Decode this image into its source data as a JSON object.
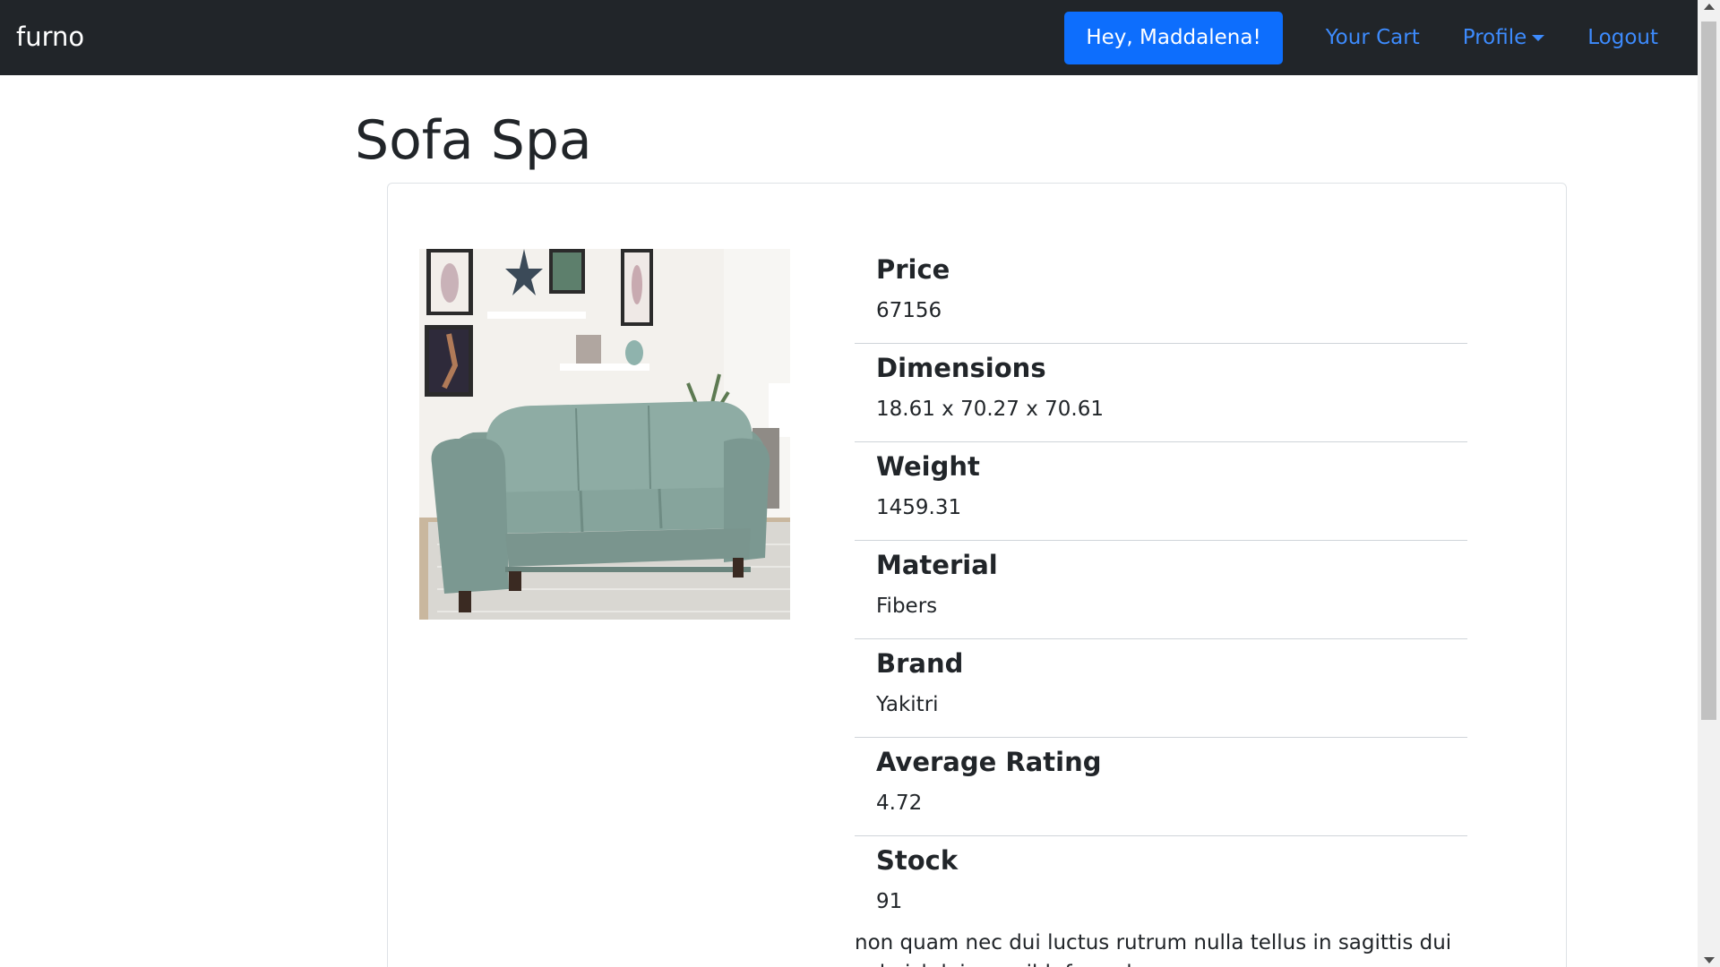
{
  "navbar": {
    "brand": "furno",
    "greeting": "Hey, Maddalena!",
    "cart": "Your Cart",
    "profile": "Profile",
    "logout": "Logout"
  },
  "product": {
    "title": "Sofa Spa",
    "image_icon": "sofa-photo",
    "specs": [
      {
        "label": "Price",
        "value": "67156"
      },
      {
        "label": "Dimensions",
        "value": "18.61 x 70.27 x 70.61"
      },
      {
        "label": "Weight",
        "value": "1459.31"
      },
      {
        "label": "Material",
        "value": "Fibers"
      },
      {
        "label": "Brand",
        "value": "Yakitri"
      },
      {
        "label": "Average Rating",
        "value": "4.72"
      },
      {
        "label": "Stock",
        "value": "91"
      }
    ],
    "description": "non quam nec dui luctus rutrum nulla tellus in sagittis dui vel nisl duis ac nibh fusce lacus"
  },
  "colors": {
    "navbar_bg": "#212529",
    "primary": "#0d6efd",
    "link": "#3d8bfd"
  }
}
